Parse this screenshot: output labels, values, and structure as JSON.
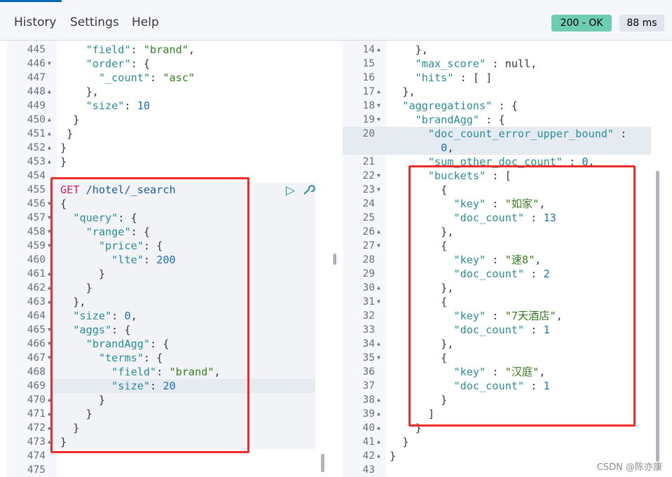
{
  "menu": {
    "history": "History",
    "settings": "Settings",
    "help": "Help"
  },
  "status": {
    "code": "200 - OK",
    "time": "88 ms",
    "ok_color": "#6dccb1",
    "time_bg": "#e0e5ee"
  },
  "request": {
    "lines": [
      {
        "n": "445",
        "fold": "",
        "t": [
          [
            "p",
            "    "
          ],
          [
            "k",
            "\"field\""
          ],
          [
            "p",
            ": "
          ],
          [
            "s",
            "\"brand\""
          ],
          [
            "p",
            ","
          ]
        ]
      },
      {
        "n": "446",
        "fold": "down",
        "t": [
          [
            "p",
            "    "
          ],
          [
            "k",
            "\"order\""
          ],
          [
            "p",
            ": {"
          ]
        ]
      },
      {
        "n": "447",
        "fold": "",
        "t": [
          [
            "p",
            "      "
          ],
          [
            "k",
            "\"_count\""
          ],
          [
            "p",
            ": "
          ],
          [
            "s",
            "\"asc\""
          ]
        ]
      },
      {
        "n": "448",
        "fold": "up",
        "t": [
          [
            "p",
            "    },"
          ]
        ]
      },
      {
        "n": "449",
        "fold": "",
        "t": [
          [
            "p",
            "    "
          ],
          [
            "k",
            "\"size\""
          ],
          [
            "p",
            ": "
          ],
          [
            "n",
            "10"
          ]
        ]
      },
      {
        "n": "450",
        "fold": "up",
        "t": [
          [
            "p",
            "  }"
          ]
        ]
      },
      {
        "n": "451",
        "fold": "up",
        "t": [
          [
            "p",
            " }"
          ]
        ]
      },
      {
        "n": "452",
        "fold": "up",
        "t": [
          [
            "p",
            "}"
          ]
        ]
      },
      {
        "n": "453",
        "fold": "up",
        "t": [
          [
            "p",
            "}"
          ]
        ]
      },
      {
        "n": "454",
        "fold": "",
        "t": []
      },
      {
        "n": "455",
        "fold": "",
        "t": [
          [
            "m",
            "GET"
          ],
          [
            "p",
            " "
          ],
          [
            "u",
            "/hotel/_search"
          ]
        ]
      },
      {
        "n": "456",
        "fold": "down",
        "t": [
          [
            "p",
            "{"
          ]
        ]
      },
      {
        "n": "457",
        "fold": "down",
        "t": [
          [
            "p",
            "  "
          ],
          [
            "k",
            "\"query\""
          ],
          [
            "p",
            ": {"
          ]
        ]
      },
      {
        "n": "458",
        "fold": "down",
        "t": [
          [
            "p",
            "    "
          ],
          [
            "k",
            "\"range\""
          ],
          [
            "p",
            ": {"
          ]
        ]
      },
      {
        "n": "459",
        "fold": "down",
        "t": [
          [
            "p",
            "      "
          ],
          [
            "k",
            "\"price\""
          ],
          [
            "p",
            ": {"
          ]
        ]
      },
      {
        "n": "460",
        "fold": "",
        "t": [
          [
            "p",
            "        "
          ],
          [
            "k",
            "\"lte\""
          ],
          [
            "p",
            ": "
          ],
          [
            "n",
            "200"
          ]
        ]
      },
      {
        "n": "461",
        "fold": "up",
        "t": [
          [
            "p",
            "      }"
          ]
        ]
      },
      {
        "n": "462",
        "fold": "up",
        "t": [
          [
            "p",
            "    }"
          ]
        ]
      },
      {
        "n": "463",
        "fold": "up",
        "t": [
          [
            "p",
            "  },"
          ]
        ]
      },
      {
        "n": "464",
        "fold": "",
        "t": [
          [
            "p",
            "  "
          ],
          [
            "k",
            "\"size\""
          ],
          [
            "p",
            ": "
          ],
          [
            "n",
            "0"
          ],
          [
            "p",
            ","
          ]
        ]
      },
      {
        "n": "465",
        "fold": "down",
        "t": [
          [
            "p",
            "  "
          ],
          [
            "k",
            "\"aggs\""
          ],
          [
            "p",
            ": {"
          ]
        ]
      },
      {
        "n": "466",
        "fold": "down",
        "t": [
          [
            "p",
            "    "
          ],
          [
            "k",
            "\"brandAgg\""
          ],
          [
            "p",
            ": {"
          ]
        ]
      },
      {
        "n": "467",
        "fold": "down",
        "t": [
          [
            "p",
            "      "
          ],
          [
            "k",
            "\"terms\""
          ],
          [
            "p",
            ": {"
          ]
        ]
      },
      {
        "n": "468",
        "fold": "",
        "t": [
          [
            "p",
            "        "
          ],
          [
            "k",
            "\"field\""
          ],
          [
            "p",
            ": "
          ],
          [
            "s",
            "\"brand\""
          ],
          [
            "p",
            ","
          ]
        ]
      },
      {
        "n": "469",
        "fold": "",
        "t": [
          [
            "p",
            "        "
          ],
          [
            "k",
            "\"size\""
          ],
          [
            "p",
            ": "
          ],
          [
            "n",
            "20"
          ]
        ]
      },
      {
        "n": "470",
        "fold": "up",
        "t": [
          [
            "p",
            "      }"
          ]
        ]
      },
      {
        "n": "471",
        "fold": "up",
        "t": [
          [
            "p",
            "    }"
          ]
        ]
      },
      {
        "n": "472",
        "fold": "up",
        "t": [
          [
            "p",
            "  }"
          ]
        ]
      },
      {
        "n": "473",
        "fold": "up",
        "t": [
          [
            "p",
            "}"
          ]
        ]
      },
      {
        "n": "474",
        "fold": "",
        "t": []
      },
      {
        "n": "475",
        "fold": "",
        "t": []
      }
    ]
  },
  "response": {
    "lines": [
      {
        "n": "14",
        "fold": "up",
        "t": [
          [
            "p",
            "    },"
          ]
        ]
      },
      {
        "n": "15",
        "fold": "",
        "t": [
          [
            "p",
            "    "
          ],
          [
            "k",
            "\"max_score\""
          ],
          [
            "p",
            " : null,"
          ]
        ]
      },
      {
        "n": "16",
        "fold": "",
        "t": [
          [
            "p",
            "    "
          ],
          [
            "k",
            "\"hits\""
          ],
          [
            "p",
            " : [ ]"
          ]
        ]
      },
      {
        "n": "17",
        "fold": "up",
        "t": [
          [
            "p",
            "  },"
          ]
        ]
      },
      {
        "n": "18",
        "fold": "down",
        "t": [
          [
            "p",
            "  "
          ],
          [
            "k",
            "\"aggregations\""
          ],
          [
            "p",
            " : {"
          ]
        ]
      },
      {
        "n": "19",
        "fold": "down",
        "t": [
          [
            "p",
            "    "
          ],
          [
            "k",
            "\"brandAgg\""
          ],
          [
            "p",
            " : {"
          ]
        ]
      },
      {
        "n": "20",
        "fold": "",
        "t": [
          [
            "p",
            "      "
          ],
          [
            "k",
            "\"doc_count_error_upper_bound\""
          ],
          [
            "p",
            " :"
          ]
        ]
      },
      {
        "n": "",
        "fold": "",
        "t": [
          [
            "p",
            "        "
          ],
          [
            "n",
            "0"
          ],
          [
            "p",
            ","
          ]
        ]
      },
      {
        "n": "21",
        "fold": "",
        "t": [
          [
            "p",
            "      "
          ],
          [
            "k",
            "\"sum_other_doc_count\""
          ],
          [
            "p",
            " : "
          ],
          [
            "n",
            "0"
          ],
          [
            "p",
            ","
          ]
        ]
      },
      {
        "n": "22",
        "fold": "down",
        "t": [
          [
            "p",
            "      "
          ],
          [
            "k",
            "\"buckets\""
          ],
          [
            "p",
            " : ["
          ]
        ]
      },
      {
        "n": "23",
        "fold": "down",
        "t": [
          [
            "p",
            "        {"
          ]
        ]
      },
      {
        "n": "24",
        "fold": "",
        "t": [
          [
            "p",
            "          "
          ],
          [
            "k",
            "\"key\""
          ],
          [
            "p",
            " : "
          ],
          [
            "s",
            "\"如家\""
          ],
          [
            "p",
            ","
          ]
        ]
      },
      {
        "n": "25",
        "fold": "",
        "t": [
          [
            "p",
            "          "
          ],
          [
            "k",
            "\"doc_count\""
          ],
          [
            "p",
            " : "
          ],
          [
            "n",
            "13"
          ]
        ]
      },
      {
        "n": "26",
        "fold": "up",
        "t": [
          [
            "p",
            "        },"
          ]
        ]
      },
      {
        "n": "27",
        "fold": "down",
        "t": [
          [
            "p",
            "        {"
          ]
        ]
      },
      {
        "n": "28",
        "fold": "",
        "t": [
          [
            "p",
            "          "
          ],
          [
            "k",
            "\"key\""
          ],
          [
            "p",
            " : "
          ],
          [
            "s",
            "\"速8\""
          ],
          [
            "p",
            ","
          ]
        ]
      },
      {
        "n": "29",
        "fold": "",
        "t": [
          [
            "p",
            "          "
          ],
          [
            "k",
            "\"doc_count\""
          ],
          [
            "p",
            " : "
          ],
          [
            "n",
            "2"
          ]
        ]
      },
      {
        "n": "30",
        "fold": "up",
        "t": [
          [
            "p",
            "        },"
          ]
        ]
      },
      {
        "n": "31",
        "fold": "down",
        "t": [
          [
            "p",
            "        {"
          ]
        ]
      },
      {
        "n": "32",
        "fold": "",
        "t": [
          [
            "p",
            "          "
          ],
          [
            "k",
            "\"key\""
          ],
          [
            "p",
            " : "
          ],
          [
            "s",
            "\"7天酒店\""
          ],
          [
            "p",
            ","
          ]
        ]
      },
      {
        "n": "33",
        "fold": "",
        "t": [
          [
            "p",
            "          "
          ],
          [
            "k",
            "\"doc_count\""
          ],
          [
            "p",
            " : "
          ],
          [
            "n",
            "1"
          ]
        ]
      },
      {
        "n": "34",
        "fold": "up",
        "t": [
          [
            "p",
            "        },"
          ]
        ]
      },
      {
        "n": "35",
        "fold": "down",
        "t": [
          [
            "p",
            "        {"
          ]
        ]
      },
      {
        "n": "36",
        "fold": "",
        "t": [
          [
            "p",
            "          "
          ],
          [
            "k",
            "\"key\""
          ],
          [
            "p",
            " : "
          ],
          [
            "s",
            "\"汉庭\""
          ],
          [
            "p",
            ","
          ]
        ]
      },
      {
        "n": "37",
        "fold": "",
        "t": [
          [
            "p",
            "          "
          ],
          [
            "k",
            "\"doc_count\""
          ],
          [
            "p",
            " : "
          ],
          [
            "n",
            "1"
          ]
        ]
      },
      {
        "n": "38",
        "fold": "up",
        "t": [
          [
            "p",
            "        }"
          ]
        ]
      },
      {
        "n": "39",
        "fold": "up",
        "t": [
          [
            "p",
            "      ]"
          ]
        ]
      },
      {
        "n": "40",
        "fold": "up",
        "t": [
          [
            "p",
            "    }"
          ]
        ]
      },
      {
        "n": "41",
        "fold": "up",
        "t": [
          [
            "p",
            "  }"
          ]
        ]
      },
      {
        "n": "42",
        "fold": "up",
        "t": [
          [
            "p",
            "}"
          ]
        ]
      },
      {
        "n": "43",
        "fold": "",
        "t": []
      }
    ]
  },
  "icons": {
    "run": "play-icon",
    "settings": "wrench-icon"
  },
  "watermark": "CSDN @陈亦康"
}
